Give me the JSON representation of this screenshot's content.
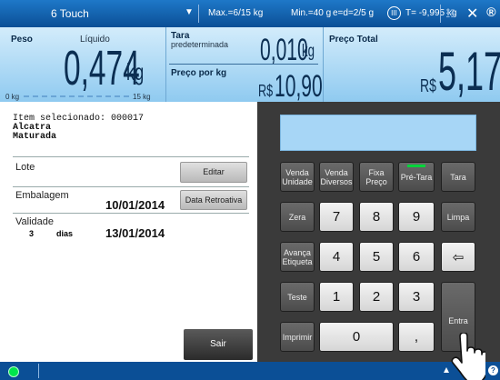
{
  "topbar": {
    "title": "6 Touch",
    "dropdown_icon": "▼",
    "max": "Max.=6/15 kg",
    "min": "Min.=40 g",
    "e": "e=d=2/5 g",
    "class": "III",
    "tare_limit": "T= -9,995 kg",
    "network_icon": "network-icon",
    "close_icon": "✕",
    "logo_icon": "®"
  },
  "display": {
    "peso_label": "Peso",
    "liquido_label": "Líquido",
    "peso_value": "0,474",
    "peso_unit": "kg",
    "scale_min": "0 kg",
    "scale_max": "15 kg",
    "tara_label": "Tara",
    "tara_sub": "predeterminada",
    "tara_value": "0,010",
    "tara_unit": "kg",
    "preco_kg_label": "Preço por kg",
    "preco_kg_currency": "R$",
    "preco_kg_value": "10,90",
    "total_label": "Preço Total",
    "total_currency": "R$",
    "total_value": "5,17"
  },
  "left": {
    "item_label": "Item selecionado: 000017",
    "item_name_1": "Alcatra",
    "item_name_2": "Maturada",
    "lote_label": "Lote",
    "editar_label": "Editar",
    "embalagem_label": "Embalagem",
    "embalagem_date": "10/01/2014",
    "data_retroativa_label": "Data Retroativa",
    "validade_label": "Validade",
    "validade_days": "3",
    "validade_days_unit": "dias",
    "validade_date": "13/01/2014",
    "sair_label": "Sair"
  },
  "keypad": {
    "venda_unidade": "Venda\nUnidade",
    "venda_diversos": "Venda\nDiversos",
    "fixa_preco": "Fixa\nPreço",
    "pre_tara": "Pré-Tara",
    "tara": "Tara",
    "zera": "Zera",
    "k7": "7",
    "k8": "8",
    "k9": "9",
    "limpa": "Limpa",
    "avanca": "Avança\nEtiqueta",
    "k4": "4",
    "k5": "5",
    "k6": "6",
    "backspace": "⇦",
    "teste": "Teste",
    "k1": "1",
    "k2": "2",
    "k3": "3",
    "entra": "Entra",
    "imprimir": "Imprimir",
    "k0": "0",
    "comma": ","
  }
}
